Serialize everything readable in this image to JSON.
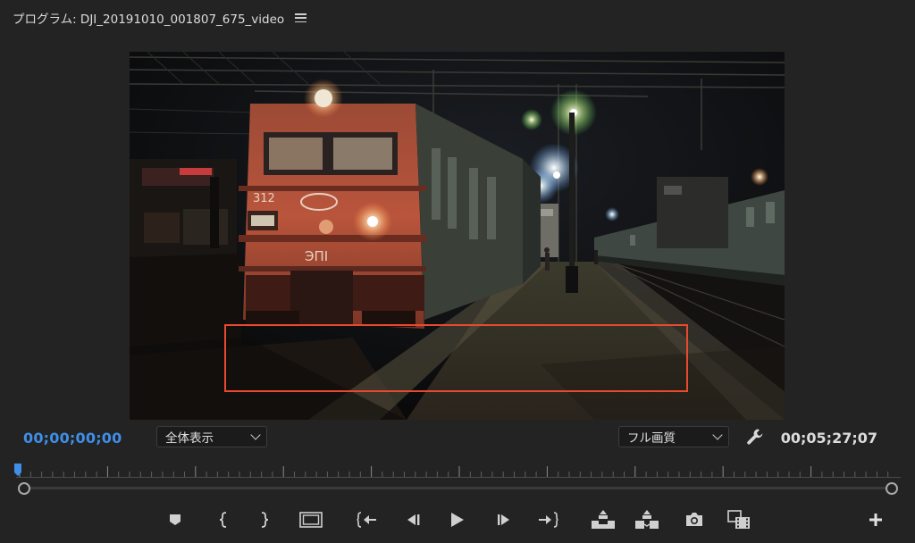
{
  "panel": {
    "title": "プログラム: DJI_20191010_001807_675_video",
    "menu_icon": "hamburger-icon"
  },
  "timecode": {
    "current": "00;00;00;00",
    "duration": "00;05;27;07"
  },
  "zoom_select": {
    "value": "全体表示"
  },
  "quality_select": {
    "value": "フル画質"
  },
  "colors": {
    "timecode_active": "#3f8ee8",
    "highlight": "#e8492f",
    "background": "#232323"
  },
  "playhead": {
    "position_fraction": 0.0
  },
  "transport": [
    "marker-icon",
    "mark-in-icon",
    "mark-out-icon",
    "safe-margins-icon",
    "go-to-in-icon",
    "step-back-icon",
    "play-icon",
    "step-forward-icon",
    "go-to-out-icon",
    "lift-icon",
    "extract-icon",
    "export-frame-icon",
    "compare-view-icon",
    "add-button-icon"
  ],
  "video_overlay": {
    "locomotive_number": "312",
    "locomotive_label": "ЭПІ"
  }
}
